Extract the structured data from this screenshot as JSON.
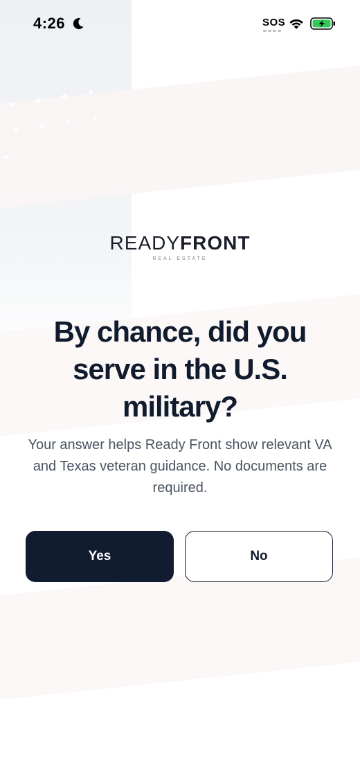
{
  "status_bar": {
    "time": "4:26",
    "sos": "SOS",
    "icons": [
      "moon-icon",
      "wifi-icon",
      "battery-charging-icon"
    ]
  },
  "logo": {
    "light": "READY",
    "bold": "FRONT",
    "sub": "REAL ESTATE"
  },
  "question": {
    "title": "By chance, did you serve in the U.S. military?",
    "description": "Your answer helps Ready Front show relevant VA and Texas veteran guidance. No documents are required."
  },
  "buttons": {
    "yes": "Yes",
    "no": "No"
  },
  "colors": {
    "primary": "#111c30",
    "text_muted": "#4a5361",
    "battery_green": "#34c759"
  }
}
